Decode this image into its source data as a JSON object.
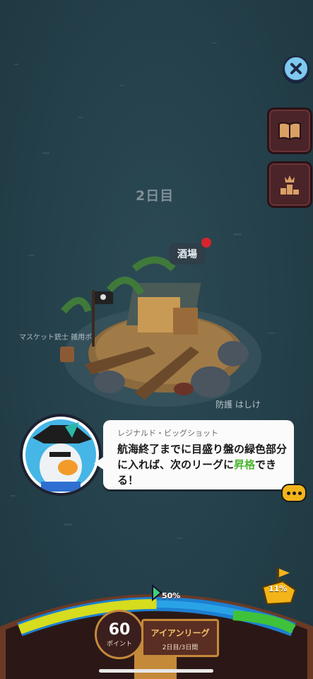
{
  "map": {
    "day_label": "2日目",
    "tavern_label": "酒場",
    "musket_label": "マスケット銃士 雑用ボ",
    "defense_label": "防護 はしけ"
  },
  "dialog": {
    "speaker": "レジナルド・ビッグショット",
    "message_part1": "航海終了までに目盛り盤の緑色部分に入れば、次のリーグに",
    "message_highlight": "昇格",
    "message_part2": "できる！"
  },
  "gauge": {
    "progress_label": "50%",
    "progress_value": 0.5,
    "trophy_percent": "11%",
    "points_value": "60",
    "points_unit": "ポイント",
    "league_name": "アイアンリーグ",
    "league_days": "2日目/3日間"
  },
  "colors": {
    "sea": "#25404a",
    "accent_green": "#4bb52f",
    "gold": "#f3b41a",
    "button_dark_red": "#4a2428"
  },
  "icons": {
    "close": "close-icon",
    "book": "book-icon",
    "leaderboard": "leaderboard-icon",
    "more": "more-icon",
    "trophy": "ship-trophy-icon"
  }
}
